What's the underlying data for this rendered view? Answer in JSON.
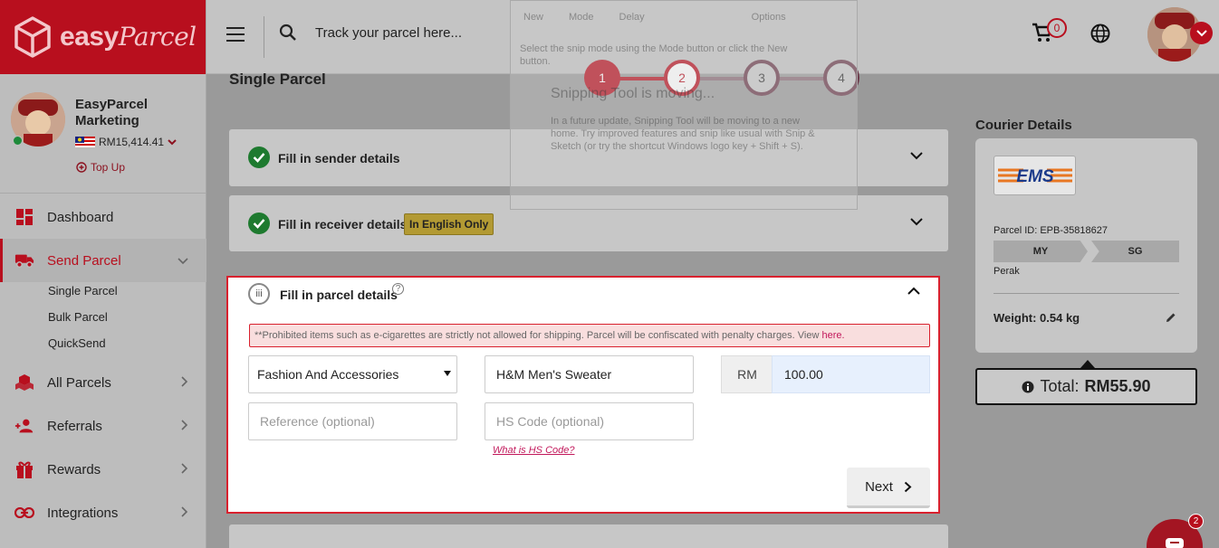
{
  "brand": {
    "logo_word": "easy",
    "logo_script": "Parcel"
  },
  "user": {
    "name": "EasyParcel Marketing",
    "balance": "RM15,414.41",
    "topup_label": "Top Up"
  },
  "sidebar": {
    "items": [
      {
        "label": "Dashboard"
      },
      {
        "label": "Send Parcel"
      },
      {
        "label": "All Parcels"
      },
      {
        "label": "Referrals"
      },
      {
        "label": "Rewards"
      },
      {
        "label": "Integrations"
      }
    ],
    "send_parcel_subitems": [
      "Single Parcel",
      "Bulk Parcel",
      "QuickSend"
    ]
  },
  "header": {
    "search_placeholder": "Track your parcel here...",
    "cart_count": "0"
  },
  "ghost_overlay": {
    "toolbar": [
      "New",
      "Mode",
      "Delay",
      "Options"
    ],
    "hint": "Select the snip mode using the Mode button or click the New button.",
    "heading": "Snipping Tool is moving...",
    "body": "In a future update, Snipping Tool will be moving to a new home. Try improved features and snip like usual with Snip & Sketch (or try the shortcut Windows logo key + Shift + S)."
  },
  "page": {
    "title": "Single Parcel"
  },
  "steps": [
    "1",
    "2",
    "3",
    "4"
  ],
  "sections": {
    "sender": {
      "label": "Fill in sender details"
    },
    "receiver": {
      "label": "Fill in receiver details",
      "badge": "In English Only"
    },
    "parcel": {
      "number": "iii",
      "label": "Fill in parcel details"
    }
  },
  "parcel_form": {
    "warning_text": "**Prohibited items such as e-cigarettes are strictly not allowed for shipping. Parcel will be confiscated with penalty charges. View ",
    "warning_link": "here.",
    "category": "Fashion And Accessories",
    "item_name": "H&M Men's Sweater",
    "currency": "RM",
    "value": "100.00",
    "reference_placeholder": "Reference (optional)",
    "hs_placeholder": "HS Code (optional)",
    "hs_link": "What is HS Code?",
    "next_label": "Next"
  },
  "courier": {
    "title": "Courier Details",
    "logo_text": "EMS",
    "parcel_id": "Parcel ID: EPB-35818627",
    "from": "MY",
    "to": "SG",
    "state": "Perak",
    "weight": "Weight: 0.54 kg",
    "total_label": "Total:",
    "total_value": "RM55.90"
  },
  "chat_badge": "2",
  "colors": {
    "brand_red": "#b80f1e",
    "success_green": "#1e7a2f",
    "link_pink": "#c2185b",
    "warning_bg": "#f9dede"
  }
}
